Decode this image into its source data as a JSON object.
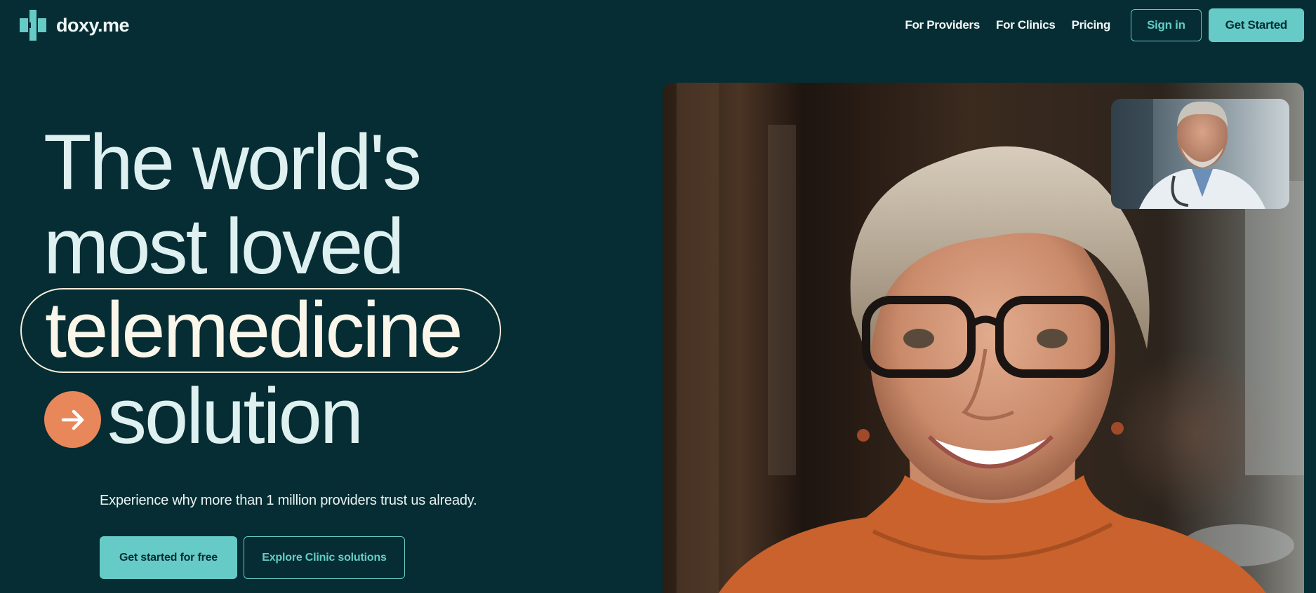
{
  "brand": {
    "name": "doxy.me",
    "accent": "#66cbc7",
    "background": "#052d33",
    "highlight": "#e8875a"
  },
  "nav": {
    "links": [
      "For Providers",
      "For Clinics",
      "Pricing"
    ],
    "sign_in": "Sign in",
    "get_started": "Get Started"
  },
  "hero": {
    "line1": "The world's",
    "line2": "most loved",
    "line3": "telemedicine",
    "line4": "solution",
    "subtitle": "Experience why more than 1 million providers trust us already.",
    "cta_primary": "Get started for free",
    "cta_secondary": "Explore Clinic solutions"
  },
  "media": {
    "main_video": "patient-video",
    "pip_video": "doctor-video"
  }
}
